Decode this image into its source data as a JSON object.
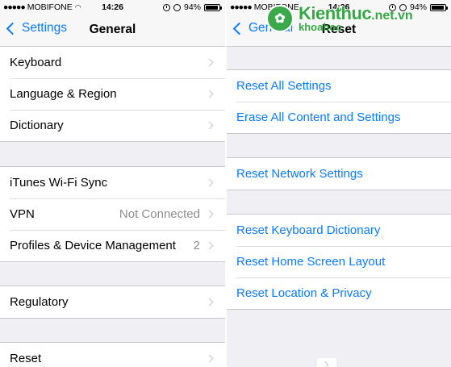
{
  "left": {
    "status": {
      "carrier": "MOBIFONE",
      "time": "14:26",
      "battery": "94%",
      "battery_fraction": 0.94
    },
    "nav": {
      "back_label": "Settings",
      "title": "General"
    },
    "groups": [
      {
        "rows": [
          {
            "label": "Keyboard"
          },
          {
            "label": "Language & Region"
          },
          {
            "label": "Dictionary"
          }
        ]
      },
      {
        "rows": [
          {
            "label": "iTunes Wi-Fi Sync"
          },
          {
            "label": "VPN",
            "value": "Not Connected"
          },
          {
            "label": "Profiles & Device Management",
            "value": "2"
          }
        ]
      },
      {
        "rows": [
          {
            "label": "Regulatory"
          }
        ]
      },
      {
        "rows": [
          {
            "label": "Reset"
          }
        ]
      }
    ]
  },
  "right": {
    "status": {
      "carrier": "MOBIFONE",
      "time": "14:26",
      "battery": "94%",
      "battery_fraction": 0.94
    },
    "nav": {
      "back_label": "General",
      "title": "Reset"
    },
    "groups": [
      {
        "rows": [
          {
            "label": "Reset All Settings"
          },
          {
            "label": "Erase All Content and Settings"
          }
        ]
      },
      {
        "rows": [
          {
            "label": "Reset Network Settings"
          }
        ]
      },
      {
        "rows": [
          {
            "label": "Reset Keyboard Dictionary"
          },
          {
            "label": "Reset Home Screen Layout"
          },
          {
            "label": "Reset Location & Privacy"
          }
        ]
      }
    ]
  },
  "watermark": {
    "brand": "Kienthuc",
    "domain": ".net.vn",
    "tagline": "khoahoc"
  },
  "colors": {
    "accent": "#0a7aff",
    "background": "#efeff4",
    "separator": "#c8c7cc",
    "secondary_text": "#8e8e93"
  }
}
